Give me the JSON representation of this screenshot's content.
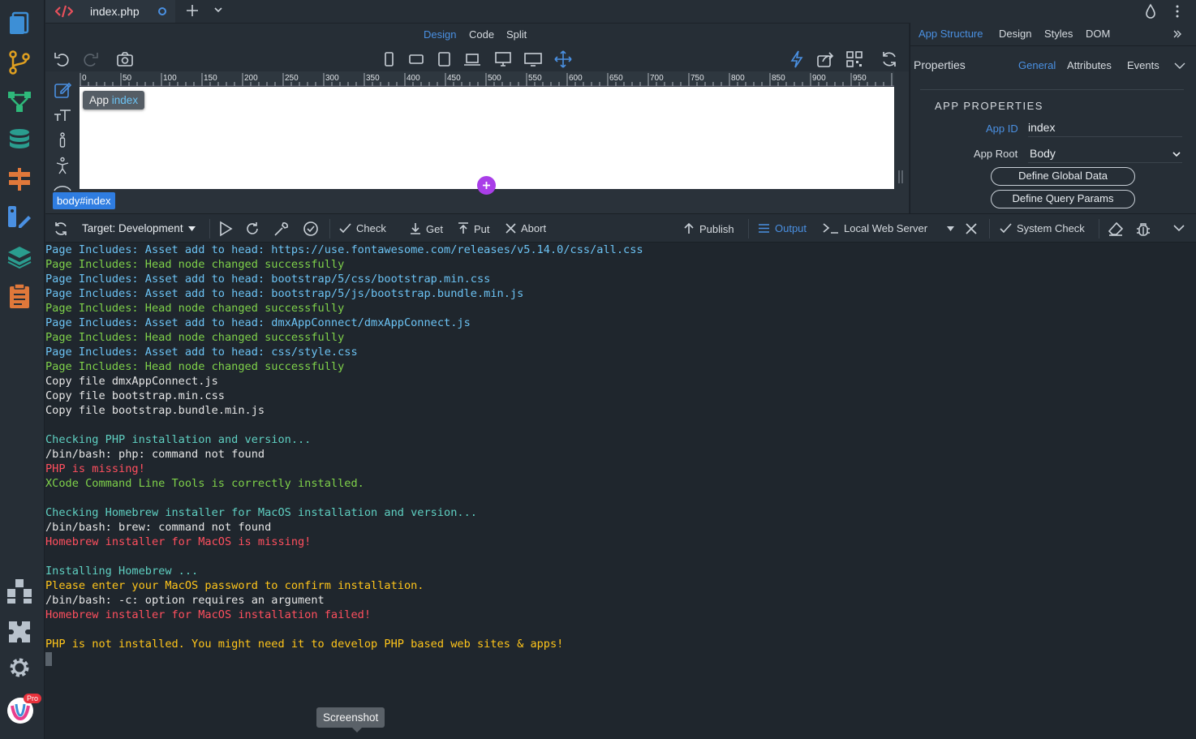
{
  "tabs": {
    "file_name": "index.php"
  },
  "view_modes": {
    "design": "Design",
    "code": "Code",
    "split": "Split"
  },
  "right_panel": {
    "tabs": {
      "app_structure": "App Structure",
      "design": "Design",
      "styles": "Styles",
      "dom": "DOM"
    },
    "properties_title": "Properties",
    "prop_tabs": {
      "general": "General",
      "attributes": "Attributes",
      "events": "Events"
    },
    "section_title": "APP PROPERTIES",
    "app_id_label": "App ID",
    "app_id_value": "index",
    "app_root_label": "App Root",
    "app_root_value": "Body",
    "define_global_data": "Define Global Data",
    "define_query_params": "Define Query Params"
  },
  "canvas": {
    "ruler_ticks": [
      "0",
      "50",
      "100",
      "150",
      "200",
      "250",
      "300",
      "350",
      "400",
      "450",
      "500",
      "550",
      "600",
      "650",
      "700",
      "750",
      "800",
      "850",
      "900",
      "950"
    ],
    "app_badge_prefix": "App",
    "app_badge_name": "index",
    "selection_badge": "body#index",
    "add_icon": "plus-circle-icon"
  },
  "output_toolbar": {
    "target_label": "Target: Development",
    "check": "Check",
    "get": "Get",
    "put": "Put",
    "abort": "Abort",
    "publish": "Publish",
    "output": "Output",
    "server": "Local Web Server",
    "system_check": "System Check"
  },
  "console_lines": [
    {
      "text": "Page Includes: Asset add to head: https://use.fontawesome.com/releases/v5.14.0/css/all.css",
      "color": "blue"
    },
    {
      "text": "Page Includes: Head node changed successfully",
      "color": "green"
    },
    {
      "text": "Page Includes: Asset add to head: bootstrap/5/css/bootstrap.min.css",
      "color": "blue"
    },
    {
      "text": "Page Includes: Asset add to head: bootstrap/5/js/bootstrap.bundle.min.js",
      "color": "blue"
    },
    {
      "text": "Page Includes: Head node changed successfully",
      "color": "green"
    },
    {
      "text": "Page Includes: Asset add to head: dmxAppConnect/dmxAppConnect.js",
      "color": "blue"
    },
    {
      "text": "Page Includes: Head node changed successfully",
      "color": "green"
    },
    {
      "text": "Page Includes: Asset add to head: css/style.css",
      "color": "blue"
    },
    {
      "text": "Page Includes: Head node changed successfully",
      "color": "green"
    },
    {
      "text": "Copy file dmxAppConnect.js",
      "color": "white"
    },
    {
      "text": "Copy file bootstrap.min.css",
      "color": "white"
    },
    {
      "text": "Copy file bootstrap.bundle.min.js",
      "color": "white"
    },
    {
      "text": "",
      "color": "white"
    },
    {
      "text": "Checking PHP installation and version...",
      "color": "teal"
    },
    {
      "text": "/bin/bash: php: command not found",
      "color": "white"
    },
    {
      "text": "PHP is missing!",
      "color": "red"
    },
    {
      "text": "XCode Command Line Tools is correctly installed.",
      "color": "green"
    },
    {
      "text": "",
      "color": "white"
    },
    {
      "text": "Checking Homebrew installer for MacOS installation and version...",
      "color": "teal"
    },
    {
      "text": "/bin/bash: brew: command not found",
      "color": "white"
    },
    {
      "text": "Homebrew installer for MacOS is missing!",
      "color": "red"
    },
    {
      "text": "",
      "color": "white"
    },
    {
      "text": "Installing Homebrew ...",
      "color": "teal"
    },
    {
      "text": "Please enter your MacOS password to confirm installation.",
      "color": "yellow"
    },
    {
      "text": "/bin/bash: -c: option requires an argument",
      "color": "white"
    },
    {
      "text": "Homebrew installer for MacOS installation failed!",
      "color": "red"
    },
    {
      "text": "",
      "color": "white"
    },
    {
      "text": "PHP is not installed. You might need it to develop PHP based web sites & apps!",
      "color": "yellow"
    }
  ],
  "tooltip": "Screenshot",
  "pro_badge": "Pro",
  "colors": {
    "accent": "#4a90e2",
    "add_button": "#a93ee8",
    "badge": "#2f7de1"
  }
}
